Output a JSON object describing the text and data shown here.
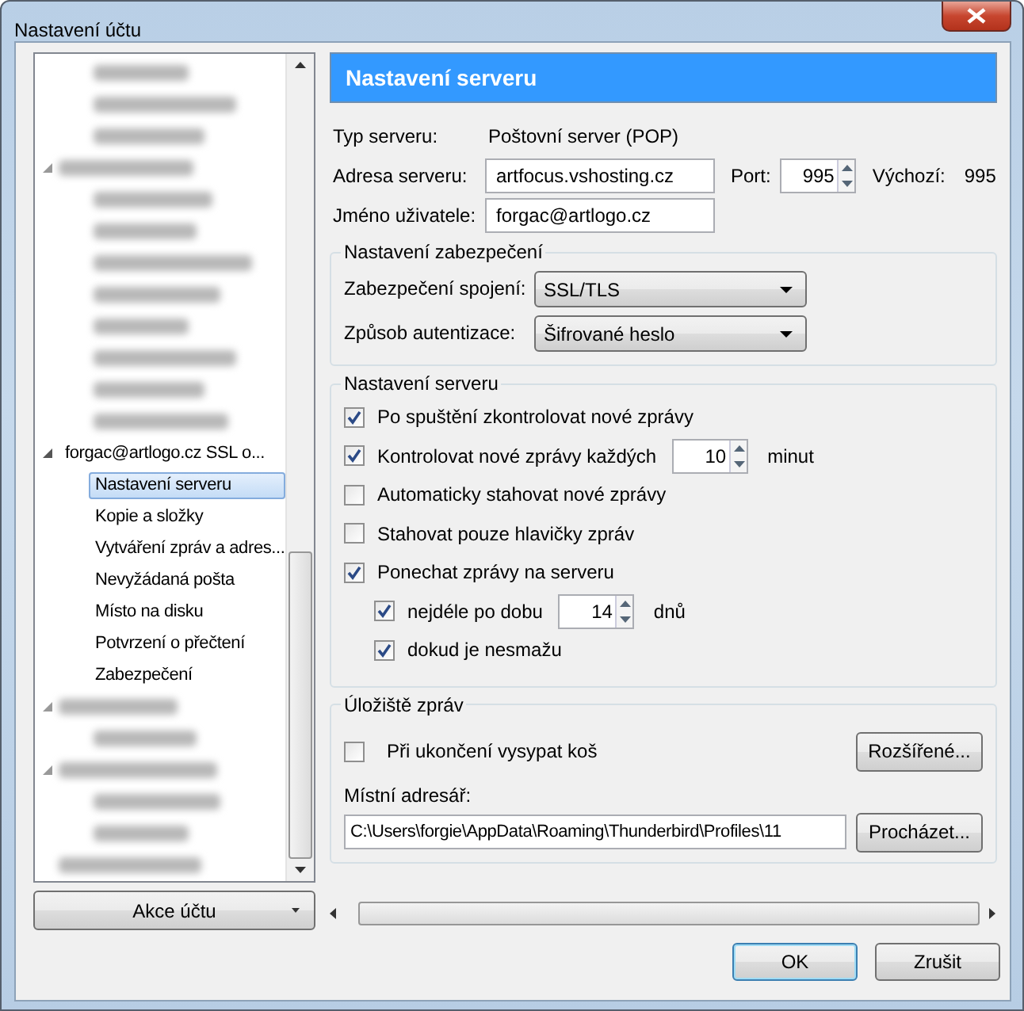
{
  "window": {
    "title": "Nastavení účtu"
  },
  "tree": {
    "nodes": [
      {
        "kind": "continuation",
        "children": [
          {
            "kind": "blurred",
            "selected": false
          },
          {
            "kind": "blurred",
            "selected": false
          },
          {
            "kind": "blurred",
            "selected": false
          }
        ]
      },
      {
        "kind": "blurred",
        "expanded": true,
        "selected": false,
        "children": [
          {
            "kind": "blurred",
            "selected": false
          },
          {
            "kind": "blurred",
            "selected": false
          },
          {
            "kind": "blurred",
            "selected": false
          },
          {
            "kind": "blurred",
            "selected": false
          },
          {
            "kind": "blurred",
            "selected": false
          },
          {
            "kind": "blurred",
            "selected": false
          },
          {
            "kind": "blurred",
            "selected": false
          },
          {
            "kind": "blurred",
            "selected": false
          }
        ]
      },
      {
        "kind": "account",
        "label": "forgac@artlogo.cz SSL o...",
        "expanded": true,
        "selected": false,
        "children": [
          {
            "kind": "item",
            "label": "Nastavení serveru",
            "selected": true
          },
          {
            "kind": "item",
            "label": "Kopie a složky",
            "selected": false
          },
          {
            "kind": "item",
            "label": "Vytváření zpráv a adres...",
            "selected": false
          },
          {
            "kind": "item",
            "label": "Nevyžádaná pošta",
            "selected": false
          },
          {
            "kind": "item",
            "label": "Místo na disku",
            "selected": false
          },
          {
            "kind": "item",
            "label": "Potvrzení o přečtení",
            "selected": false
          },
          {
            "kind": "item",
            "label": "Zabezpečení",
            "selected": false
          }
        ]
      },
      {
        "kind": "blurred",
        "expanded": true,
        "selected": false,
        "children": [
          {
            "kind": "blurred",
            "selected": false
          }
        ]
      },
      {
        "kind": "blurred",
        "expanded": true,
        "selected": false,
        "children": [
          {
            "kind": "blurred",
            "selected": false
          },
          {
            "kind": "blurred",
            "selected": false
          }
        ]
      },
      {
        "kind": "blurred",
        "selected": false
      }
    ]
  },
  "account_actions_button": {
    "label": "Akce účtu"
  },
  "panel": {
    "title": "Nastavení serveru",
    "server_type": {
      "label": "Typ serveru:",
      "value": "Poštovní server (POP)"
    },
    "server_address": {
      "label": "Adresa serveru:",
      "value": "artfocus.vshosting.cz"
    },
    "port": {
      "label": "Port:",
      "value": "995"
    },
    "default_port": {
      "label": "Výchozí:",
      "value": "995"
    },
    "user_name": {
      "label": "Jméno uživatele:",
      "value": "forgac@artlogo.cz"
    },
    "security": {
      "title": "Nastavení zabezpečení",
      "rows": [
        {
          "label": "Zabezpečení spojení:",
          "value": "SSL/TLS"
        },
        {
          "label": "Způsob autentizace:",
          "value": "Šifrované heslo"
        }
      ]
    },
    "server_settings": {
      "title": "Nastavení serveru",
      "options": [
        {
          "label": "Po spuštění zkontrolovat nové zprávy",
          "checked": true
        },
        {
          "label": "Kontrolovat nové zprávy každých",
          "checked": true,
          "spinner": {
            "value": "10",
            "unit": "minut"
          }
        },
        {
          "label": "Automaticky stahovat nové zprávy",
          "checked": false
        },
        {
          "label": "Stahovat pouze hlavičky zpráv",
          "checked": false
        },
        {
          "label": "Ponechat zprávy na serveru",
          "checked": true,
          "children": [
            {
              "label": "nejdéle po dobu",
              "checked": true,
              "spinner": {
                "value": "14",
                "unit": "dnů"
              }
            },
            {
              "label": "dokud je nesmažu",
              "checked": true
            }
          ]
        }
      ]
    },
    "storage": {
      "title": "Úložiště zpráv",
      "empty_trash": {
        "label": "Při ukončení vysypat koš",
        "checked": false
      },
      "advanced_button": "Rozšířené...",
      "local_directory": {
        "label": "Místní adresář:",
        "value": "C:\\Users\\forgie\\AppData\\Roaming\\Thunderbird\\Profiles\\11"
      },
      "browse_button": "Procházet..."
    }
  },
  "buttons": [
    {
      "label": "OK",
      "default": true
    },
    {
      "label": "Zrušit",
      "default": false
    }
  ]
}
